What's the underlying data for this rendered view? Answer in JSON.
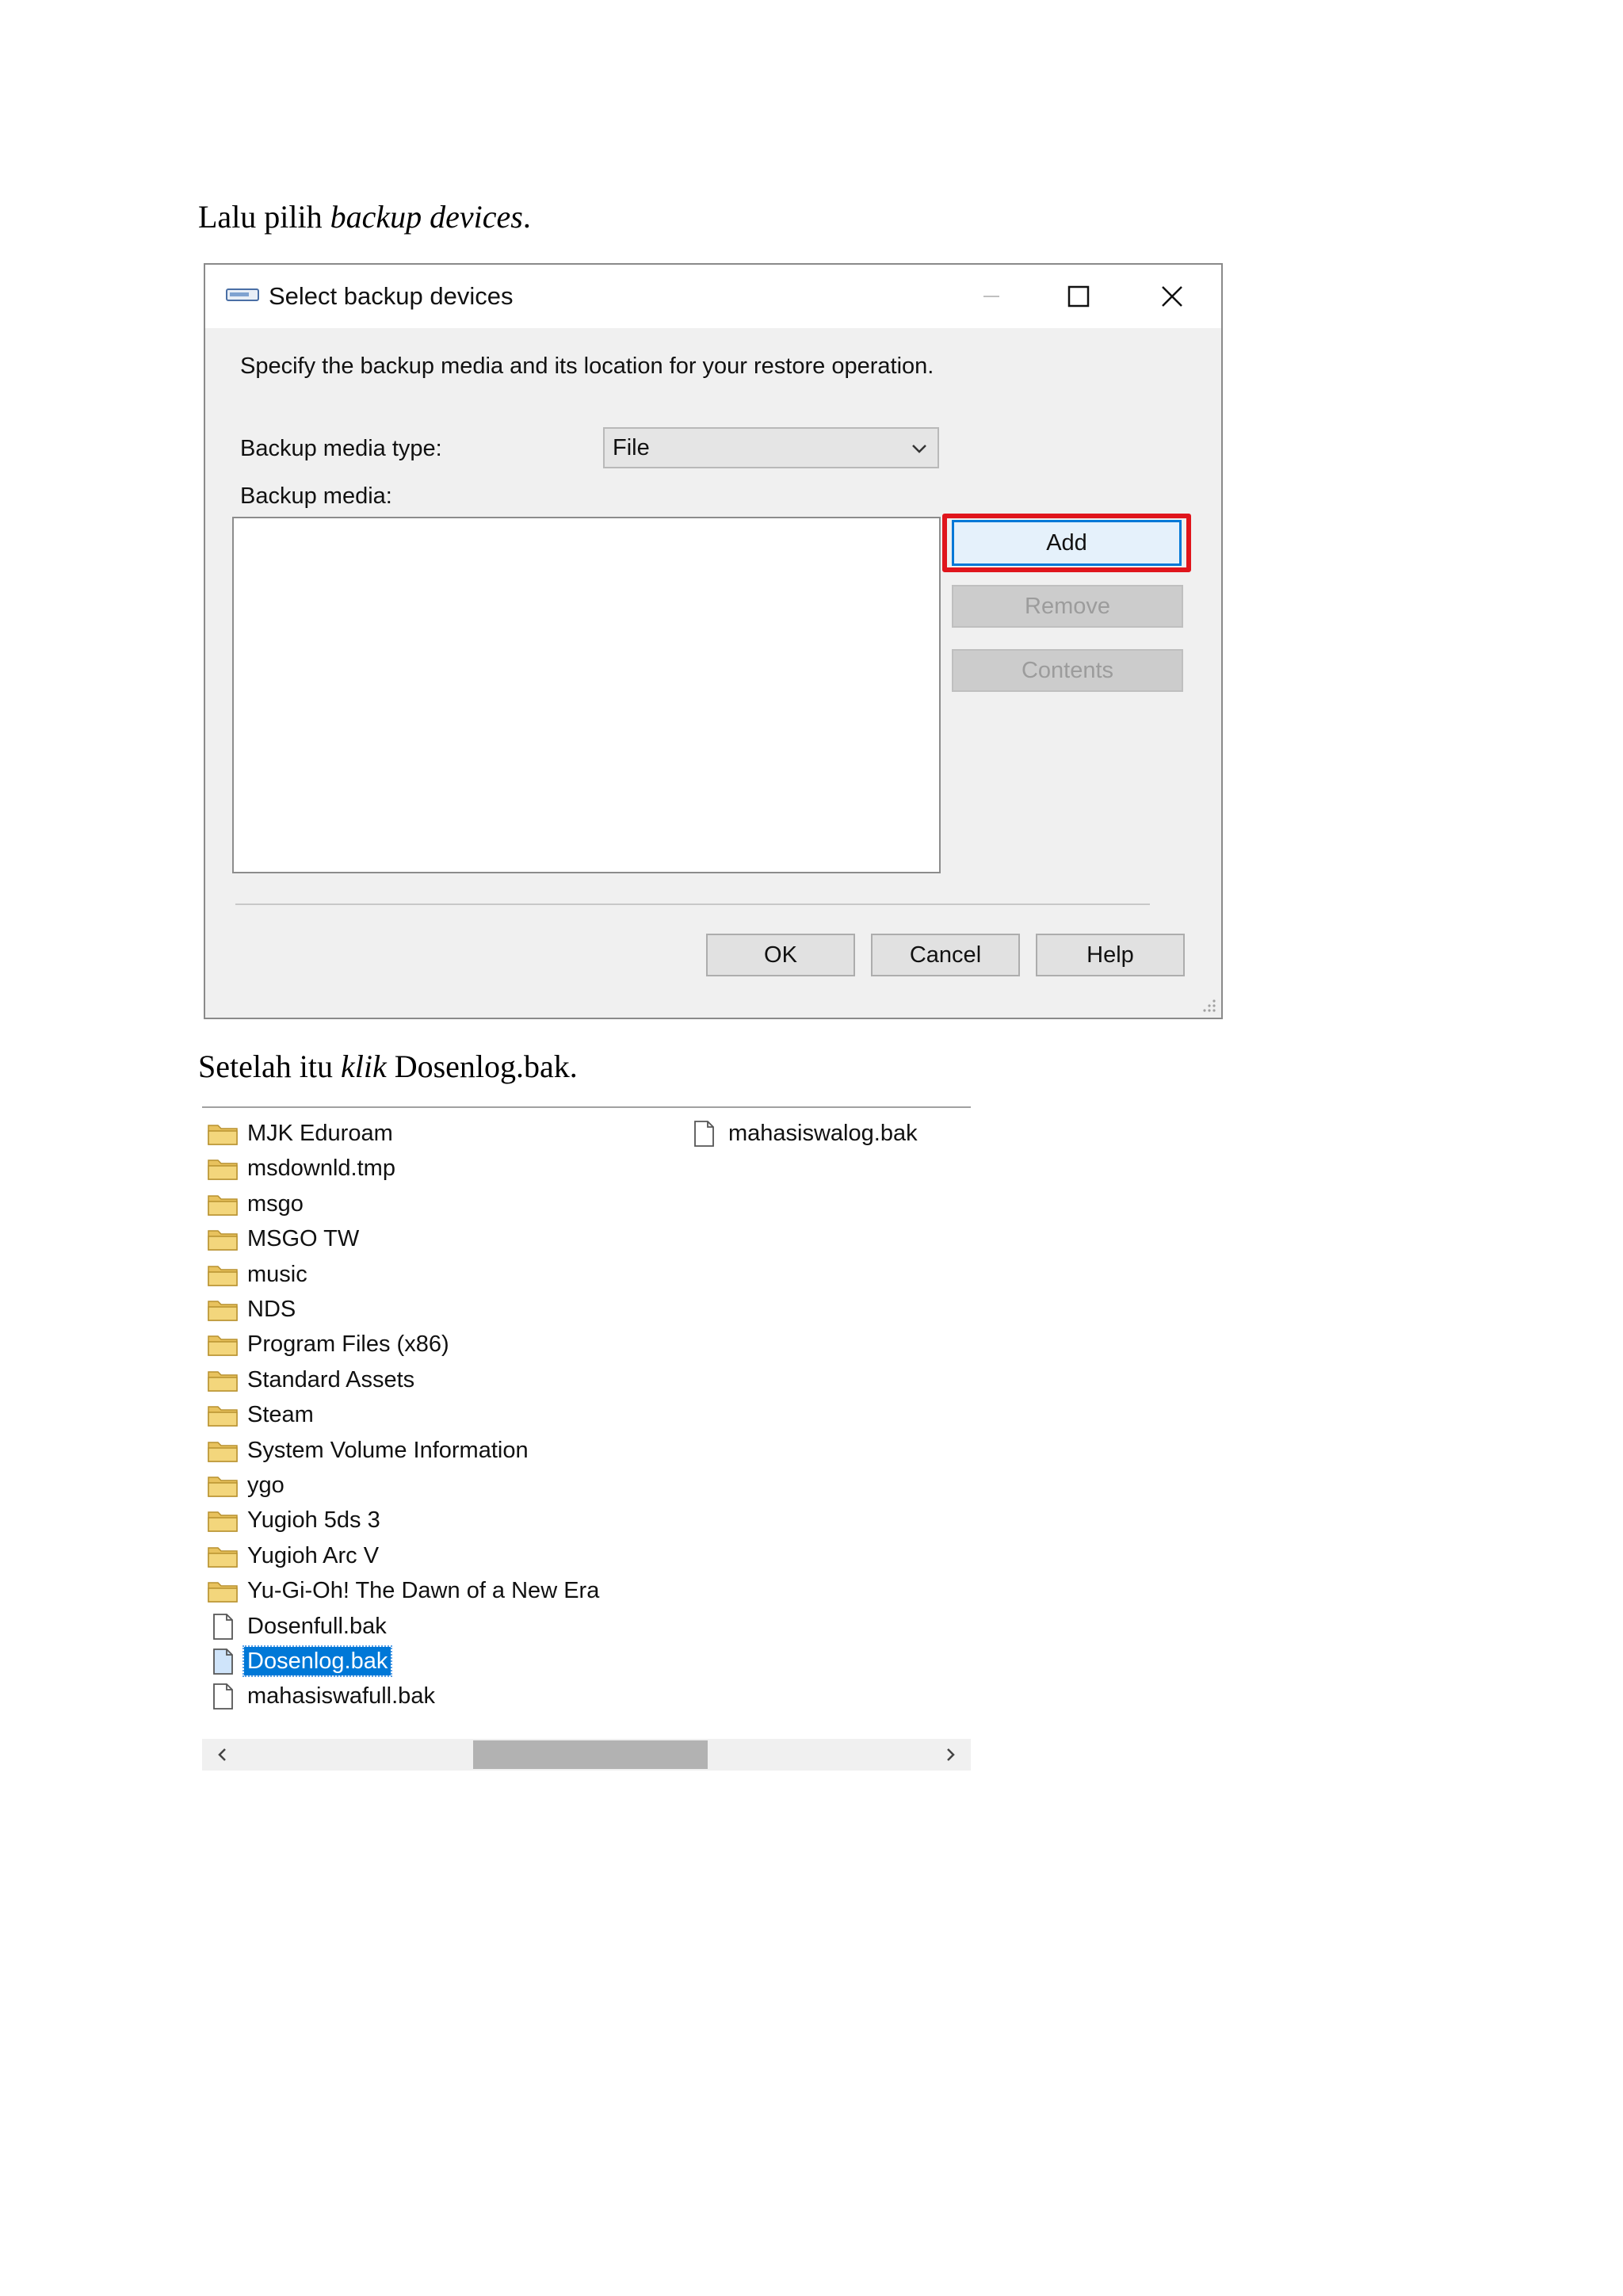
{
  "doc": {
    "step1": {
      "normal": "Lalu pilih ",
      "italic": "backup devices",
      "tail": "."
    },
    "step2": {
      "normal": "Setelah itu ",
      "italic": "klik",
      "tail": " Dosenlog.bak."
    }
  },
  "dialog": {
    "title": "Select backup devices",
    "description": "Specify the backup media and its location for your restore operation.",
    "media_type_label": "Backup media type:",
    "media_type_value": "File",
    "media_label": "Backup media:",
    "buttons": {
      "add": "Add",
      "remove": "Remove",
      "contents": "Contents",
      "ok": "OK",
      "cancel": "Cancel",
      "help": "Help"
    },
    "highlight_color": "#e0151c"
  },
  "files": {
    "column1": [
      {
        "name": "MJK Eduroam",
        "type": "folder"
      },
      {
        "name": "msdownld.tmp",
        "type": "folder"
      },
      {
        "name": "msgo",
        "type": "folder"
      },
      {
        "name": "MSGO TW",
        "type": "folder"
      },
      {
        "name": "music",
        "type": "folder"
      },
      {
        "name": "NDS",
        "type": "folder"
      },
      {
        "name": "Program Files (x86)",
        "type": "folder"
      },
      {
        "name": "Standard Assets",
        "type": "folder"
      },
      {
        "name": "Steam",
        "type": "folder"
      },
      {
        "name": "System Volume Information",
        "type": "folder"
      },
      {
        "name": "ygo",
        "type": "folder"
      },
      {
        "name": "Yugioh 5ds 3",
        "type": "folder"
      },
      {
        "name": "Yugioh Arc V",
        "type": "folder"
      },
      {
        "name": "Yu-Gi-Oh! The Dawn of a New Era",
        "type": "folder"
      },
      {
        "name": "Dosenfull.bak",
        "type": "file"
      },
      {
        "name": "Dosenlog.bak",
        "type": "file",
        "selected": true
      },
      {
        "name": "mahasiswafull.bak",
        "type": "file"
      }
    ],
    "column2": [
      {
        "name": "mahasiswalog.bak",
        "type": "file"
      }
    ],
    "selection_color": "#0078d7"
  }
}
